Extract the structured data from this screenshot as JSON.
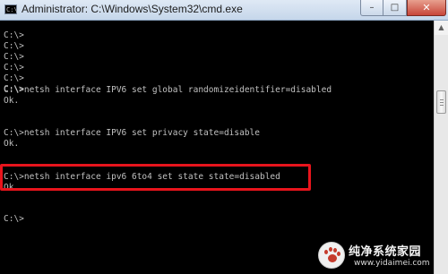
{
  "window": {
    "title": "Administrator: C:\\Windows\\System32\\cmd.exe",
    "app_icon_text": "C:\\"
  },
  "controls": {
    "minimize": "–",
    "maximize": "□",
    "close": "✕"
  },
  "console": {
    "lines": [
      "C:\\>",
      "C:\\>",
      "C:\\>",
      "C:\\>",
      "C:\\>",
      "C:\\>",
      "C:\\>netsh interface IPV6 set global randomizeidentifier=disabled",
      "Ok.",
      "",
      "C:\\>netsh interface IPV6 set privacy state=disable",
      "Ok.",
      "",
      "",
      "C:\\>netsh interface ipv6 6to4 set state state=disabled",
      "Ok.",
      "",
      "",
      "C:\\>"
    ]
  },
  "scrollbar": {
    "up_arrow": "▲"
  },
  "watermark": {
    "title": "纯净系统家园",
    "url": "www.yidaimei.com"
  },
  "colors": {
    "console_bg": "#000000",
    "console_text": "#c0c0c0",
    "highlight": "#e8141c",
    "close_button": "#c7463a"
  }
}
